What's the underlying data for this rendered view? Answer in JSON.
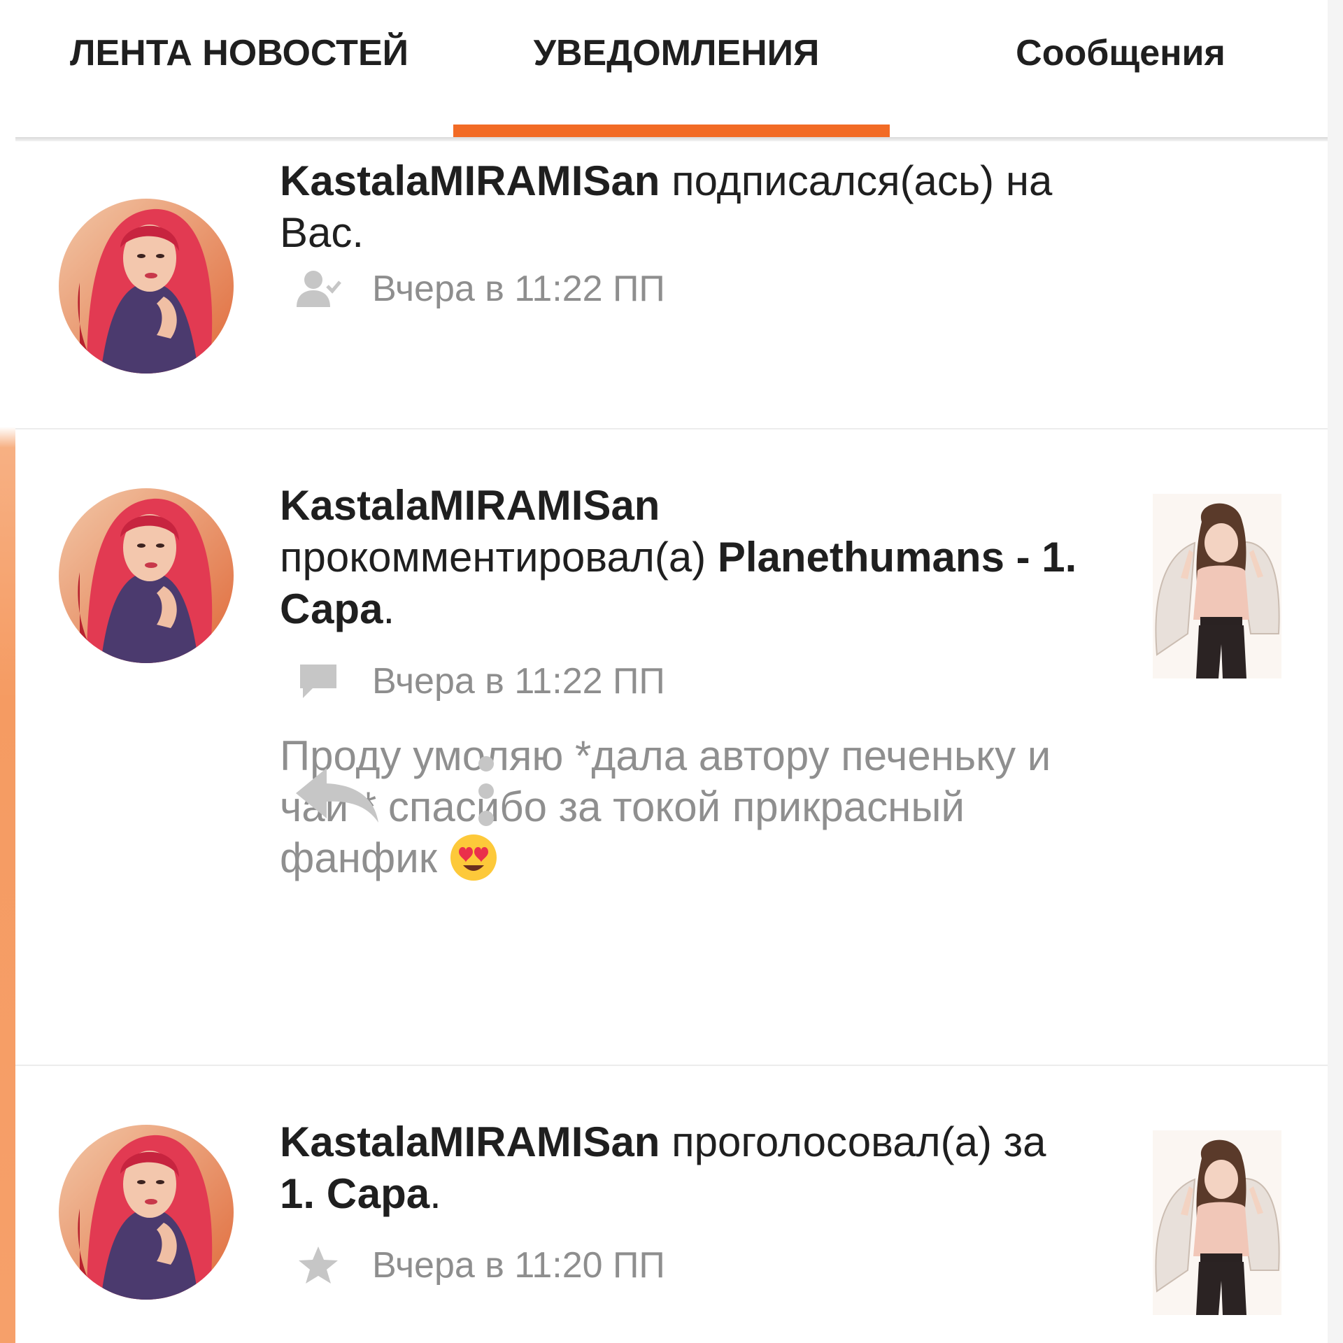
{
  "tabs": [
    {
      "label": "ЛЕНТА НОВОСТЕЙ",
      "active": false
    },
    {
      "label": "УВЕДОМЛЕНИЯ",
      "active": true
    },
    {
      "label": "Сообщения",
      "active": false
    }
  ],
  "accent_color": "#f26b25",
  "notifications": [
    {
      "user": "KastalaMIRAMISan",
      "action": " подписался(ась) на Вас.",
      "icon": "follow-icon",
      "time": "Вчера в 11:22 ПП",
      "unread": false
    },
    {
      "user": "KastalaMIRAMISan",
      "action": "прокомментировал(а) ",
      "work": "Planethumans - 1. Сара",
      "end": ".",
      "icon": "comment-icon",
      "time": "Вчера в 11:22 ПП",
      "comment": "Проду умоляю *дала автору печеньку и чай * спасибо за токой прикрасный фанфик",
      "comment_emoji": "heart-eyes-emoji",
      "unread": true,
      "actions": [
        "reply-icon",
        "more-vertical-icon"
      ]
    },
    {
      "user": "KastalaMIRAMISan",
      "action": " проголосовал(а) за ",
      "work": "1. Сара",
      "end": ".",
      "icon": "star-icon",
      "time": "Вчера в 11:20 ПП",
      "unread": true
    }
  ]
}
